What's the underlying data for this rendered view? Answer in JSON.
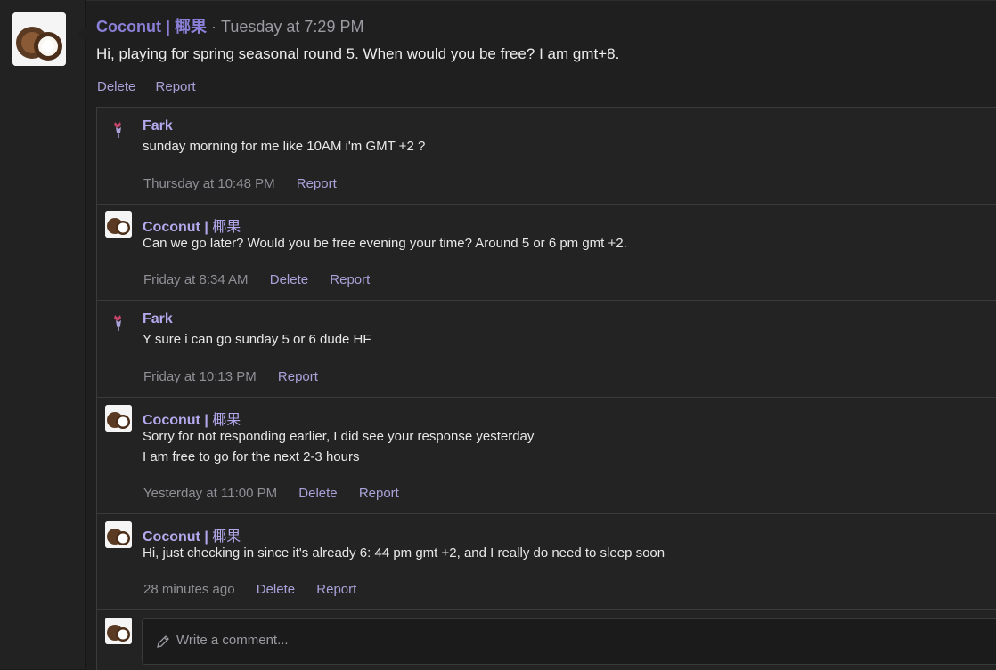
{
  "post": {
    "author": "Coconut | 椰果",
    "separator": " · ",
    "time": "Tuesday at 7:29 PM",
    "body": "Hi, playing for spring seasonal round 5. When would you be free? I am gmt+8.",
    "actions": {
      "delete": "Delete",
      "report": "Report"
    }
  },
  "comments": [
    {
      "author": "Fark",
      "lines": [
        "sunday morning for me like 10AM i'm GMT +2 ?"
      ],
      "time": "Thursday at 10:48 PM",
      "report": "Report"
    },
    {
      "author_name": "Coconut | ",
      "author_cn": "椰果",
      "lines": [
        "Can we go later? Would you be free evening your time? Around 5 or 6 pm gmt +2."
      ],
      "time": "Friday at 8:34 AM",
      "delete": "Delete",
      "report": "Report"
    },
    {
      "author": "Fark",
      "lines": [
        "Y sure i can go sunday 5 or 6 dude HF"
      ],
      "time": "Friday at 10:13 PM",
      "report": "Report"
    },
    {
      "author_name": "Coconut | ",
      "author_cn": "椰果",
      "lines": [
        "Sorry for not responding earlier, I did see your response yesterday",
        "I am free to go for the next 2-3 hours"
      ],
      "time": "Yesterday at 11:00 PM",
      "delete": "Delete",
      "report": "Report"
    },
    {
      "author_name": "Coconut | ",
      "author_cn": "椰果",
      "lines": [
        "Hi, just checking in since it's already 6: 44 pm gmt +2, and I really do need to sleep soon"
      ],
      "time": "28 minutes ago",
      "delete": "Delete",
      "report": "Report"
    }
  ],
  "composer": {
    "placeholder": "Write a comment..."
  },
  "colors": {
    "accent": "#8a80d8",
    "link": "#a9a2d8",
    "background": "#1f1f20"
  },
  "icons": {
    "avatar": "coconut-avatar-icon",
    "fark": "rooster-icon",
    "pencil": "pencil-icon"
  }
}
